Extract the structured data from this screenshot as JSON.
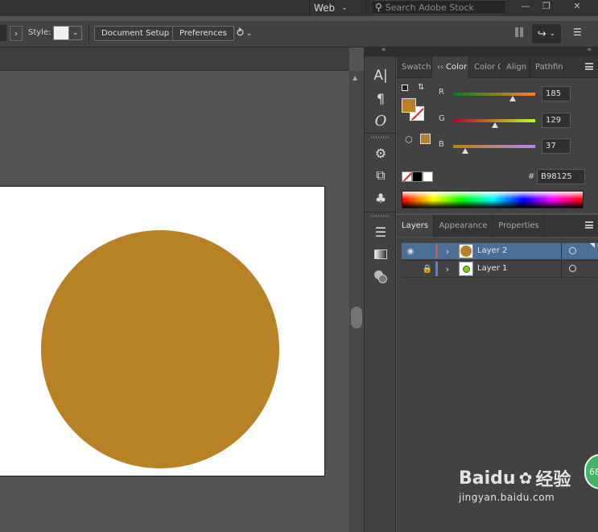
{
  "topbar": {
    "workspace": "Web",
    "search_placeholder": "Search Adobe Stock"
  },
  "controlbar": {
    "style_label": "Style:",
    "document_setup": "Document Setup",
    "preferences": "Preferences"
  },
  "colors": {
    "fill": "#B98125",
    "layer2_bar": "#e05050",
    "layer1_bar": "#5a7fe0"
  },
  "color_panel": {
    "tabs": [
      "Swatch",
      "Color",
      "Color G",
      "Align",
      "Pathfin"
    ],
    "active_tab": "Color",
    "r_label": "R",
    "g_label": "G",
    "b_label": "B",
    "r_value": "185",
    "g_value": "129",
    "b_value": "37",
    "hash": "#",
    "hex": "B98125"
  },
  "layers_panel": {
    "tabs": [
      "Layers",
      "Appearance",
      "Properties"
    ],
    "active_tab": "Layers",
    "layers": [
      {
        "name": "Layer 2",
        "selected": true
      },
      {
        "name": "Layer 1",
        "selected": false
      }
    ]
  },
  "watermark": {
    "brand": "Baidu",
    "cn": "经验",
    "url": "jingyan.baidu.com"
  },
  "badge": "68"
}
